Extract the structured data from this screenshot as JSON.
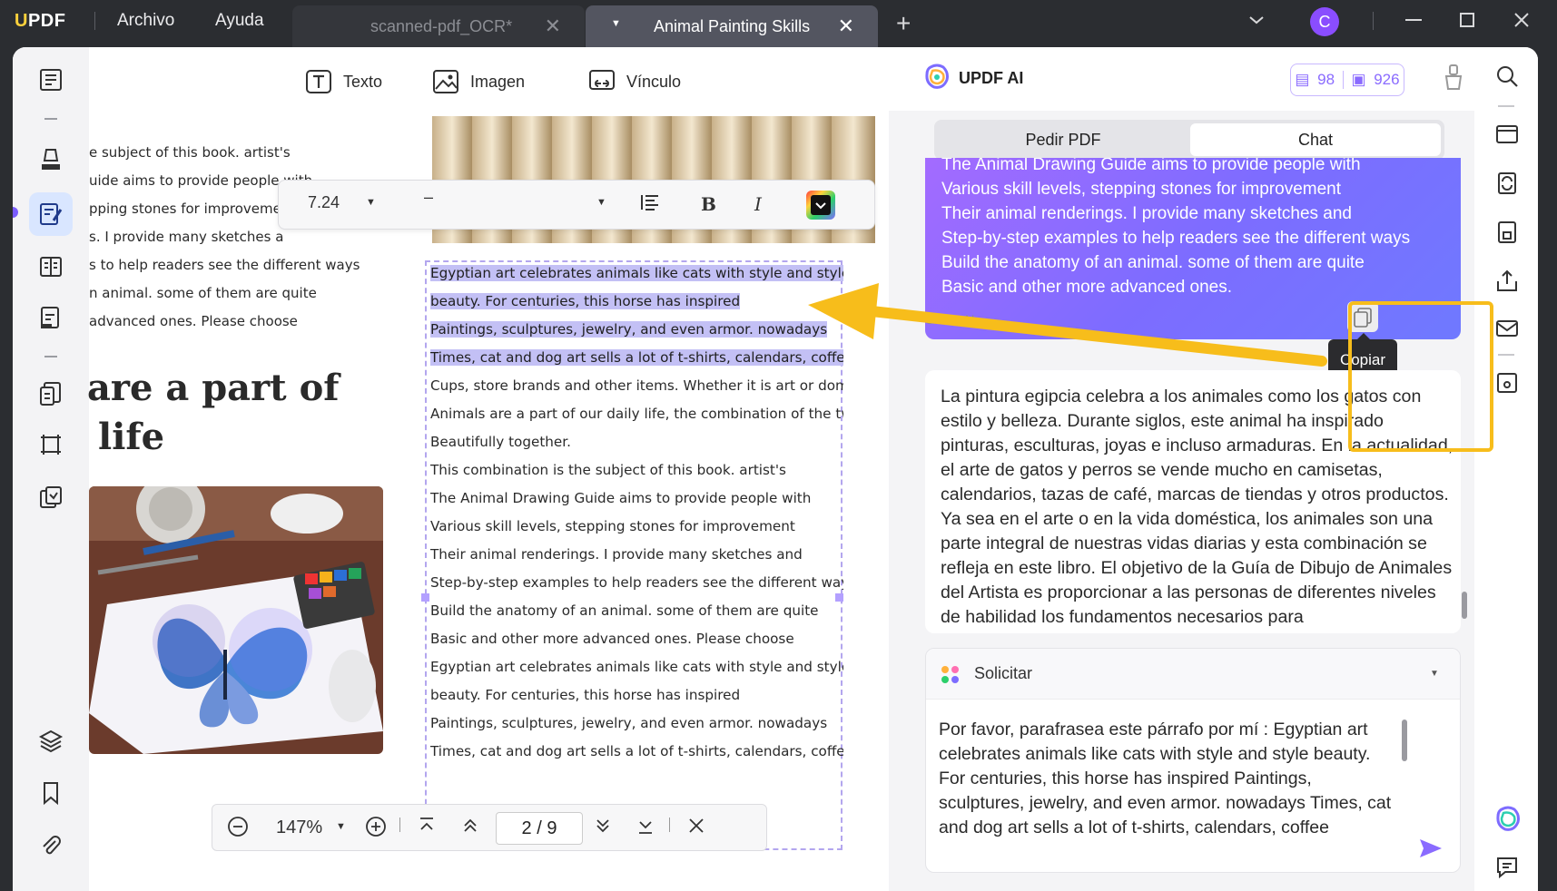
{
  "titlebar": {
    "logo": "UPDF",
    "menu": [
      "Archivo",
      "Ayuda"
    ],
    "tabs": [
      {
        "label": "scanned-pdf_OCR*",
        "active": false
      },
      {
        "label": "Animal Painting Skills",
        "active": true
      }
    ],
    "avatar_letter": "C"
  },
  "toolbar": {
    "text_label": "Texto",
    "image_label": "Imagen",
    "link_label": "Vínculo"
  },
  "format_bar": {
    "font_size": "7.24",
    "font_family": "–",
    "bold": "B",
    "italic": "I"
  },
  "document": {
    "left_lines": [
      "e subject of this book. artist's",
      "uide aims to provide people with",
      "pping stones for improveme",
      "s. I provide many sketches a",
      "s to help readers see the different ways",
      "n animal. some of them are quite",
      "advanced ones. Please choose"
    ],
    "heading_line1": "are a part of",
    "heading_line2": "life",
    "selected_lines": [
      "Egyptian art celebrates animals like cats with style and style",
      "beauty. For centuries, this horse has inspired",
      "Paintings, sculptures, jewelry, and even armor. nowadays",
      "Times, cat and dog art sells a lot of t-shirts, calendars, coffee"
    ],
    "body_lines": [
      "Cups, store brands and other items. Whether it is art or domestic",
      "Animals are a part of our daily life, the combination of the two",
      "Beautifully together.",
      "This combination is the subject of this book. artist's",
      "The Animal Drawing Guide aims to provide people with",
      "Various skill levels, stepping stones for improvement",
      "Their animal renderings. I provide many sketches and",
      "Step-by-step examples to help readers see the different ways",
      "Build the anatomy of an animal. some of them are quite",
      "Basic and other more advanced ones. Please choose",
      "Egyptian art celebrates animals like cats with style and style",
      "beauty. For centuries, this horse has inspired",
      "Paintings, sculptures, jewelry, and even armor. nowadays",
      "Times, cat and dog art sells a lot of t-shirts, calendars, coffee"
    ]
  },
  "zoom_bar": {
    "zoom": "147%",
    "current_page": "2",
    "separator": "/",
    "total_pages": "9"
  },
  "ai_panel": {
    "title": "UPDF AI",
    "credits_docs": "98",
    "credits_chat": "926",
    "tabs": [
      "Pedir PDF",
      "Chat"
    ],
    "active_tab": "Chat",
    "user_message_lines": [
      "The Animal Drawing Guide aims to provide people with",
      "Various skill levels, stepping stones for improvement",
      "Their animal renderings. I provide many sketches and",
      "Step-by-step examples to help readers see the different ways",
      "Build the anatomy of an animal. some of them are quite",
      "Basic and other more advanced ones."
    ],
    "assistant_label": "UPDF AI",
    "assistant_answer": "La pintura egipcia celebra a los animales como los gatos con estilo y belleza. Durante siglos, este animal ha inspirado pinturas, esculturas, joyas e incluso armaduras. En la actualidad, el arte de gatos y perros se vende mucho en camisetas, calendarios, tazas de café, marcas de tiendas y otros productos. Ya sea en el arte o en la vida doméstica, los animales son una parte integral de nuestras vidas diarias y esta combinación se refleja en este libro. El objetivo de la Guía de Dibujo de Animales del Artista es proporcionar a las personas de diferentes niveles de habilidad los fundamentos necesarios para",
    "copy_tooltip": "Copiar",
    "prompt_selector": "Solicitar",
    "prompt_text": "Por favor, parafrasea este párrafo por mí : Egyptian art celebrates animals like cats with style and style beauty. For centuries, this horse has inspired Paintings, sculptures, jewelry, and even armor. nowadays Times, cat and dog art sells a lot of t-shirts, calendars, coffee"
  },
  "colors": {
    "accent": "#7d6cff",
    "highlight": "#f7bd1b",
    "selection": "#c3c0f5"
  }
}
